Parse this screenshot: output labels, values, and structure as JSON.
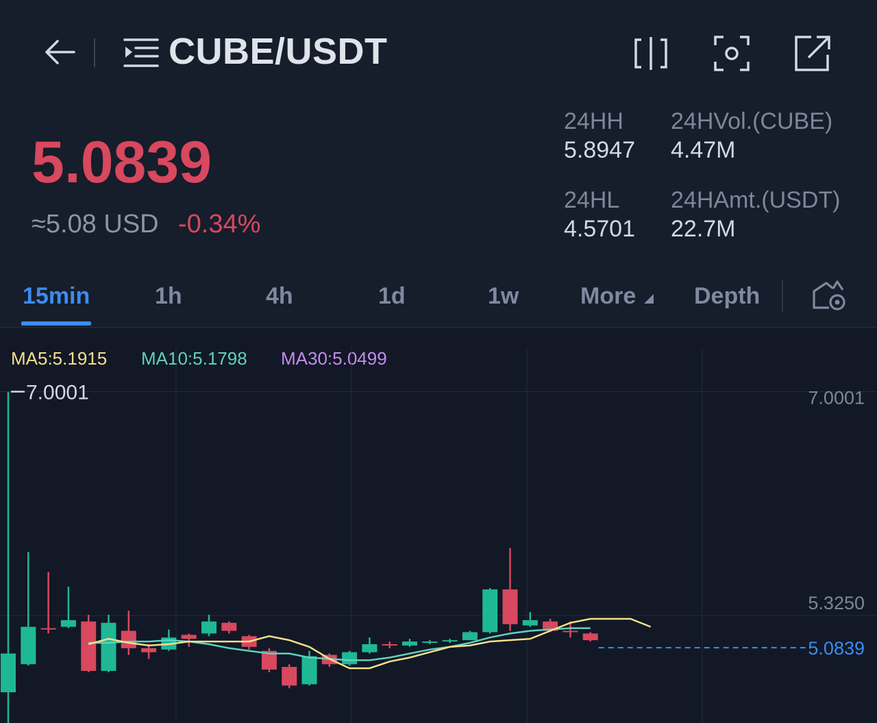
{
  "header": {
    "pair": "CUBE/USDT",
    "icons": [
      "arrow-left-icon",
      "list-menu-icon",
      "split-screen-icon",
      "scan-icon",
      "external-link-icon"
    ]
  },
  "ticker": {
    "last_price": "5.0839",
    "usd_approx": "≈5.08 USD",
    "change_pct": "-0.34%",
    "stats": {
      "high_label": "24HH",
      "high_value": "5.8947",
      "low_label": "24HL",
      "low_value": "4.5701",
      "vol_label": "24HVol.(CUBE)",
      "vol_value": "4.47M",
      "amt_label": "24HAmt.(USDT)",
      "amt_value": "22.7M"
    }
  },
  "tabs": {
    "items": [
      "15min",
      "1h",
      "4h",
      "1d",
      "1w",
      "More",
      "Depth"
    ],
    "active": "15min"
  },
  "indicators": {
    "ma5": "MA5:5.1915",
    "ma10": "MA10:5.1798",
    "ma30": "MA30:5.0499"
  },
  "colors": {
    "background": "#161d2b",
    "up": "#1fb895",
    "down": "#d8485e",
    "accent": "#3b8cf0",
    "ma5": "#f4e08a",
    "ma10": "#5fd1c0",
    "ma30": "#c48cf0"
  },
  "chart_data": {
    "type": "candlestick",
    "interval": "15min",
    "price_labels": {
      "max_marker": "7.0001",
      "axis_top": "7.0001",
      "axis_mid": "5.3250",
      "current": "5.0839"
    },
    "ylim": [
      4.52,
      7.48
    ],
    "candles": [
      {
        "o": 4.75,
        "c": 5.04,
        "h": 7.0,
        "l": 4.52
      },
      {
        "o": 4.96,
        "c": 5.24,
        "h": 5.8,
        "l": 4.95
      },
      {
        "o": 5.23,
        "c": 5.22,
        "h": 5.65,
        "l": 5.19
      },
      {
        "o": 5.24,
        "c": 5.29,
        "h": 5.54,
        "l": 5.23
      },
      {
        "o": 5.28,
        "c": 4.91,
        "h": 5.33,
        "l": 4.9
      },
      {
        "o": 4.91,
        "c": 5.27,
        "h": 5.33,
        "l": 4.9
      },
      {
        "o": 5.21,
        "c": 5.08,
        "h": 5.36,
        "l": 5.03
      },
      {
        "o": 5.08,
        "c": 5.05,
        "h": 5.11,
        "l": 5.0
      },
      {
        "o": 5.07,
        "c": 5.16,
        "h": 5.22,
        "l": 5.06
      },
      {
        "o": 5.18,
        "c": 5.15,
        "h": 5.19,
        "l": 5.09
      },
      {
        "o": 5.19,
        "c": 5.28,
        "h": 5.33,
        "l": 5.17
      },
      {
        "o": 5.27,
        "c": 5.21,
        "h": 5.28,
        "l": 5.19
      },
      {
        "o": 5.17,
        "c": 5.09,
        "h": 5.18,
        "l": 5.07
      },
      {
        "o": 5.06,
        "c": 4.92,
        "h": 5.08,
        "l": 4.9
      },
      {
        "o": 4.94,
        "c": 4.8,
        "h": 4.96,
        "l": 4.78
      },
      {
        "o": 4.81,
        "c": 5.02,
        "h": 5.06,
        "l": 4.8
      },
      {
        "o": 5.03,
        "c": 4.96,
        "h": 5.04,
        "l": 4.94
      },
      {
        "o": 4.96,
        "c": 5.05,
        "h": 5.06,
        "l": 4.95
      },
      {
        "o": 5.05,
        "c": 5.11,
        "h": 5.16,
        "l": 5.04
      },
      {
        "o": 5.11,
        "c": 5.1,
        "h": 5.13,
        "l": 5.08
      },
      {
        "o": 5.1,
        "c": 5.13,
        "h": 5.15,
        "l": 5.09
      },
      {
        "o": 5.12,
        "c": 5.13,
        "h": 5.14,
        "l": 5.11
      },
      {
        "o": 5.13,
        "c": 5.14,
        "h": 5.15,
        "l": 5.12
      },
      {
        "o": 5.14,
        "c": 5.2,
        "h": 5.21,
        "l": 5.14
      },
      {
        "o": 5.2,
        "c": 5.52,
        "h": 5.53,
        "l": 5.19
      },
      {
        "o": 5.52,
        "c": 5.26,
        "h": 5.83,
        "l": 5.21
      },
      {
        "o": 5.25,
        "c": 5.29,
        "h": 5.35,
        "l": 5.24
      },
      {
        "o": 5.28,
        "c": 5.21,
        "h": 5.3,
        "l": 5.2
      },
      {
        "o": 5.21,
        "c": 5.2,
        "h": 5.28,
        "l": 5.16
      },
      {
        "o": 5.19,
        "c": 5.14,
        "h": 5.2,
        "l": 5.13
      }
    ],
    "ma5": [
      5.11,
      5.15,
      5.12,
      5.1,
      5.11,
      5.13,
      5.13,
      5.13,
      5.13,
      5.17,
      5.14,
      5.09,
      5.0,
      4.93,
      4.93,
      4.98,
      5.01,
      5.05,
      5.09,
      5.1,
      5.13,
      5.14,
      5.15,
      5.21,
      5.27,
      5.3,
      5.3,
      5.3,
      5.24
    ],
    "ma10": [
      5.12,
      5.12,
      5.13,
      5.13,
      5.14,
      5.13,
      5.11,
      5.08,
      5.06,
      5.04,
      5.04,
      5.01,
      5.0,
      4.99,
      4.99,
      5.01,
      5.04,
      5.07,
      5.09,
      5.12,
      5.16,
      5.19,
      5.21,
      5.22,
      5.23,
      5.23
    ]
  }
}
